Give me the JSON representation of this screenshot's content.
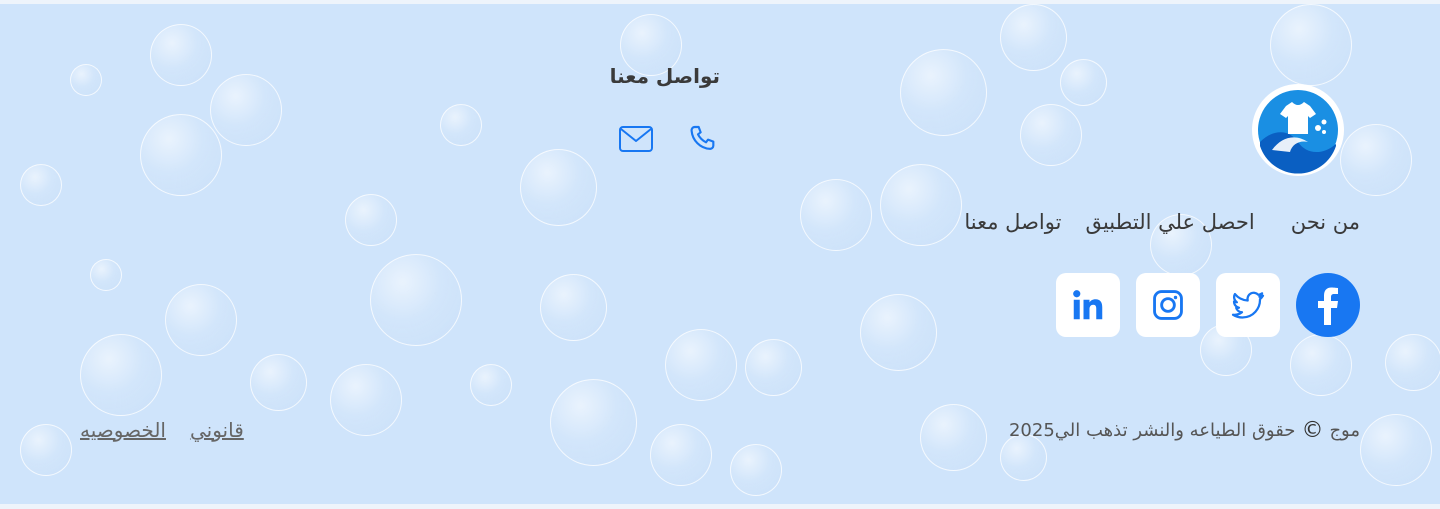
{
  "brand": {
    "logo_icon": "wave-shirt-logo-icon"
  },
  "nav": {
    "items": [
      {
        "label": "من نحن"
      },
      {
        "label": "احصل علي التطبيق"
      },
      {
        "label": "تواصل معنا"
      }
    ]
  },
  "social": {
    "items": [
      {
        "name": "facebook-icon"
      },
      {
        "name": "twitter-icon"
      },
      {
        "name": "instagram-icon"
      },
      {
        "name": "linkedin-icon"
      }
    ]
  },
  "contact": {
    "title": "تواصل معنا",
    "icons": [
      "mail-icon",
      "phone-icon"
    ]
  },
  "footer": {
    "copyright_text": "حقوق الطياعه والنشر تذهب الي2025",
    "copyright_symbol": "©",
    "brand_name": "موج",
    "legal_links": [
      {
        "label": "قانوني"
      },
      {
        "label": "الخصوصيه"
      }
    ]
  },
  "colors": {
    "background": "#cfe4fb",
    "accent": "#1877f2",
    "text": "#3a3a3a"
  }
}
